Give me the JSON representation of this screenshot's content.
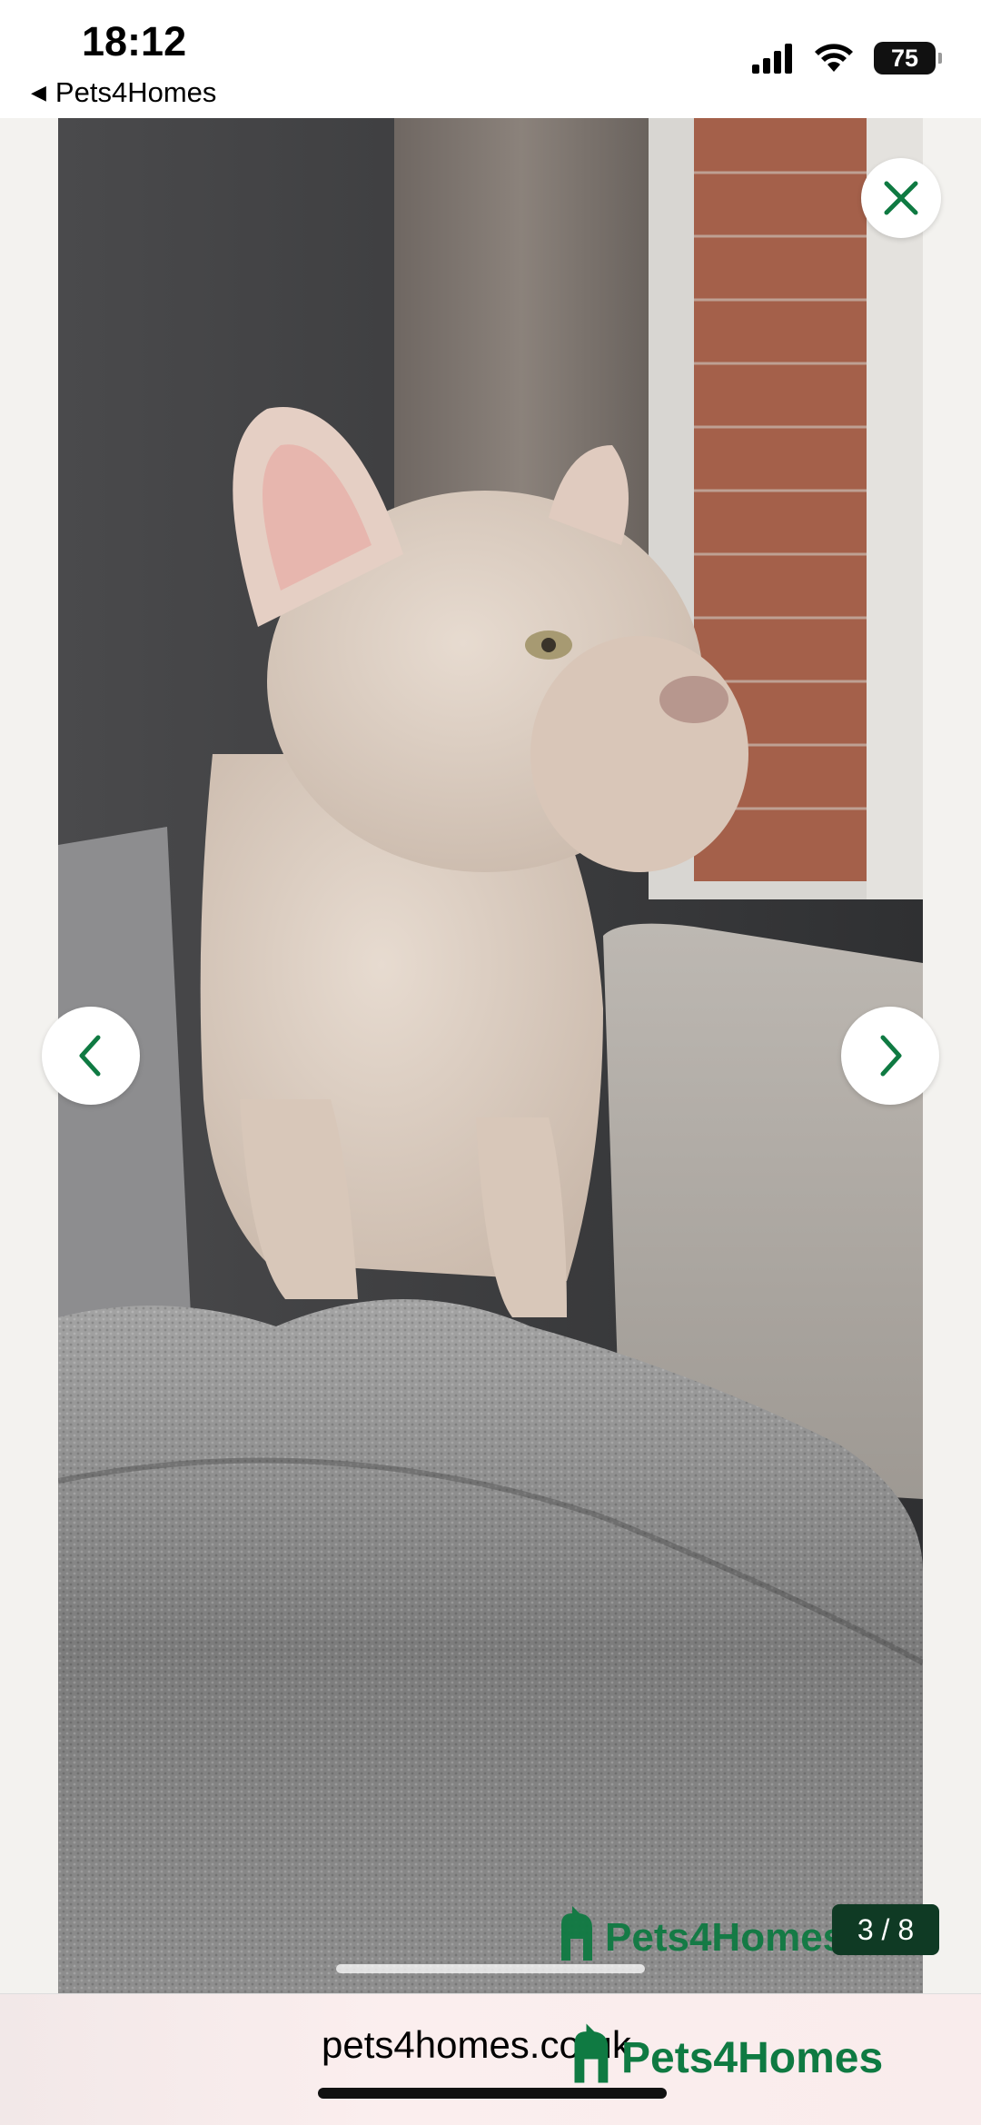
{
  "status_bar": {
    "time": "18:12",
    "back_app": "Pets4Homes",
    "battery": "75"
  },
  "gallery": {
    "counter": "3 / 8",
    "watermark": "Pets4Homes",
    "image_description": "dog-photo"
  },
  "browser": {
    "url": "pets4homes.co.uk",
    "brand": "Pets4Homes"
  },
  "colors": {
    "brand_green": "#0f7a42",
    "counter_bg": "#0f3a24"
  }
}
